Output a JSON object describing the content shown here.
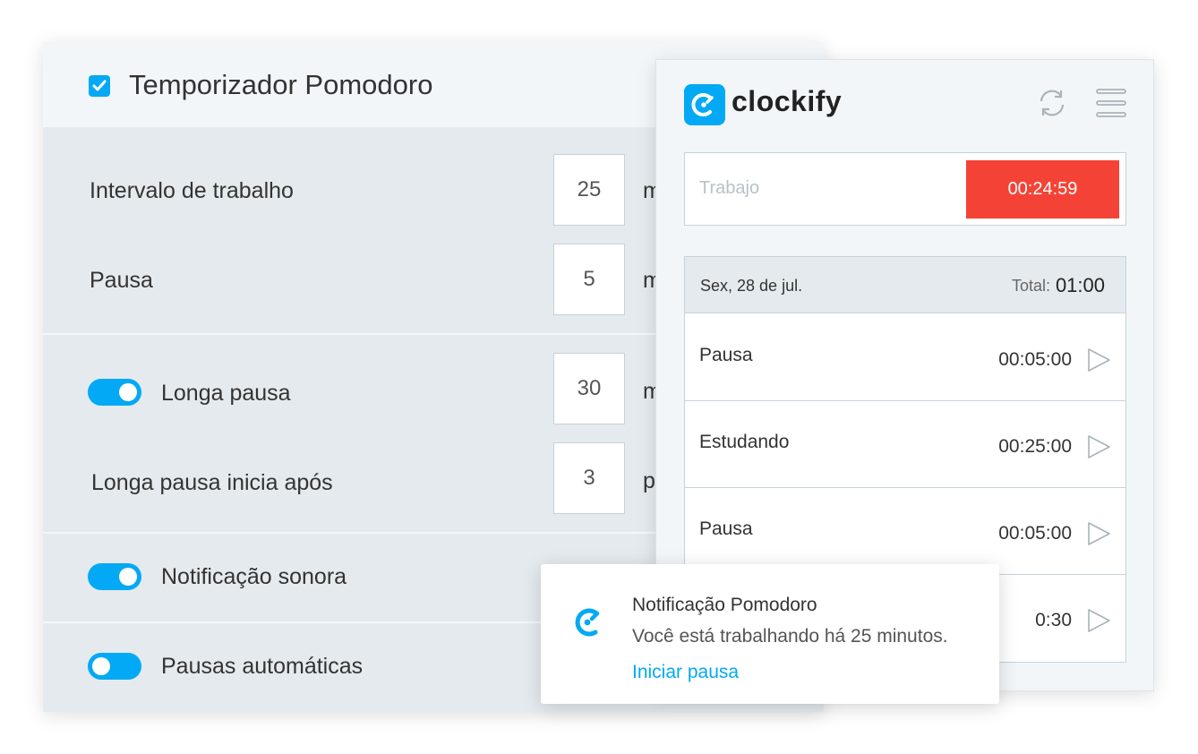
{
  "settings": {
    "title": "Temporizador Pomodoro",
    "title_checked": true,
    "work_interval": {
      "label": "Intervalo de trabalho",
      "value": "25",
      "unit": "m"
    },
    "break": {
      "label": "Pausa",
      "value": "5",
      "unit": "m"
    },
    "long_break": {
      "label": "Longa pausa",
      "enabled": true,
      "value": "30",
      "unit": "m"
    },
    "long_break_after": {
      "label": "Longa pausa inicia após",
      "value": "3",
      "unit": "p"
    },
    "sound_notification": {
      "label": "Notificação sonora",
      "enabled": true
    },
    "auto_breaks": {
      "label": "Pausas automáticas",
      "enabled": false
    }
  },
  "clockify": {
    "brand": "clockify",
    "timer": {
      "description": "Trabajo",
      "time": "00:24:59",
      "button_color": "#f44336"
    },
    "day": {
      "date": "Sex, 28 de jul.",
      "total_label": "Total:",
      "total": "01:00"
    },
    "entries": [
      {
        "description": "Pausa",
        "duration": "00:05:00"
      },
      {
        "description": "Estudando",
        "duration": "00:25:00"
      },
      {
        "description": "Pausa",
        "duration": "00:05:00"
      },
      {
        "description": "",
        "duration": "0:30"
      }
    ]
  },
  "notification": {
    "title": "Notificação Pomodoro",
    "body": "Você está trabalhando há 25 minutos.",
    "action": "Iniciar pausa"
  },
  "colors": {
    "accent": "#03a9f4",
    "timer_running": "#f44336"
  }
}
